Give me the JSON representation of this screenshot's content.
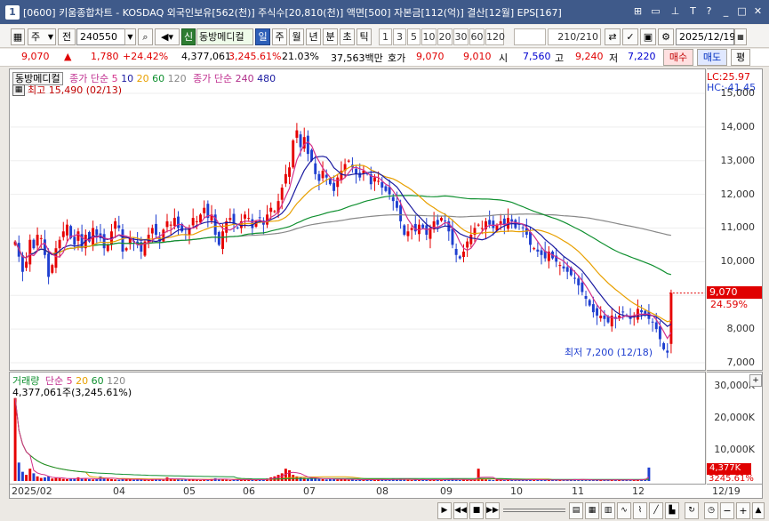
{
  "window": {
    "title": "[0600] 키움종합차트 - KOSDAQ 외국인보유[562(천)] 주식수[20,810(천)] 액면[500] 자본금[112(억)] 결산[12월] EPS[167]",
    "index": "1"
  },
  "toolbar": {
    "market": "주",
    "kind": "전",
    "code": "240550",
    "badge_credit": "신",
    "stock_name": "동방메디컬",
    "periods": [
      "일",
      "주",
      "월",
      "년",
      "분",
      "초",
      "틱"
    ],
    "active_period": "일",
    "intervals": [
      "1",
      "3",
      "5",
      "10",
      "20",
      "30",
      "60",
      "120"
    ],
    "count": "210/210",
    "date": "2025/12/19"
  },
  "quote": {
    "price": "9,070",
    "arrow": "▲",
    "change": "1,780",
    "rate": "+24.42%",
    "volume": "4,377,061",
    "vol_ratio": "3,245.61%",
    "turnover": "21.03%",
    "amount": "37,563백만",
    "hoga_label": "호가",
    "hoga_ask": "9,070",
    "hoga_bid": "9,010",
    "open_label": "시",
    "open": "7,560",
    "high_label": "고",
    "high": "9,240",
    "low_label": "저",
    "low": "7,220",
    "buy": "매수",
    "sell": "매도",
    "avg": "평"
  },
  "price_legend": {
    "name": "동방메디컬",
    "ma_label": "종가 단순",
    "ma": [
      "5",
      "10",
      "20",
      "60",
      "120"
    ],
    "ma2_label": "종가 단순",
    "ma2": [
      "240",
      "480"
    ],
    "max_label": "최고 15,490 (02/13)",
    "min_label": "최저 7,200 (12/18)"
  },
  "price_scale": {
    "lc": "LC:25.97",
    "hc": "HC:-41.45",
    "ticks": [
      "15,000",
      "14,000",
      "13,000",
      "12,000",
      "11,000",
      "10,000",
      "9,000",
      "8,000",
      "7,000"
    ],
    "cur": "9,070",
    "cur_rate": "24.59%"
  },
  "vol_legend": {
    "name": "거래량",
    "ma_label": "단순",
    "ma": [
      "5",
      "20",
      "60",
      "120"
    ],
    "cur": "4,377,061주(3,245.61%)"
  },
  "vol_scale": {
    "ticks": [
      "30,000K",
      "20,000K",
      "10,000K"
    ],
    "cur": "4,377K",
    "cur_rate": "3245.61%"
  },
  "dates": [
    "2025/02",
    "04",
    "05",
    "06",
    "07",
    "08",
    "09",
    "10",
    "11",
    "12",
    "12/19"
  ],
  "colors": {
    "up": "#e60000",
    "down": "#1f3fd0",
    "ma5": "#d4308a",
    "ma10": "#1a1aa0",
    "ma20": "#e8a000",
    "ma60": "#109030",
    "ma120": "#888888",
    "ma240": "#b0308a"
  },
  "chart_data": {
    "type": "candlestick",
    "ylim": [
      7000,
      15500
    ],
    "closes": [
      10600,
      10150,
      9700,
      10000,
      10650,
      10400,
      10800,
      10700,
      10200,
      9550,
      9900,
      10400,
      10650,
      10900,
      11100,
      10700,
      10500,
      10900,
      10400,
      10800,
      10600,
      11000,
      10800,
      10700,
      10400,
      10500,
      10900,
      11200,
      11000,
      10300,
      10400,
      10700,
      10600,
      10500,
      10300,
      10600,
      10800,
      11000,
      10800,
      10600,
      10950,
      11200,
      11100,
      11300,
      11000,
      10900,
      10800,
      11000,
      11300,
      11200,
      11400,
      11600,
      11300,
      11400,
      10800,
      10500,
      10900,
      11200,
      11300,
      11100,
      11000,
      11200,
      11400,
      11300,
      11000,
      11200,
      11300,
      11100,
      11400,
      11600,
      11500,
      11800,
      12200,
      12600,
      12800,
      13600,
      13900,
      13400,
      13700,
      13200,
      13000,
      12600,
      12400,
      12700,
      12500,
      12300,
      12100,
      12500,
      12700,
      12900,
      13000,
      12800,
      12600,
      12500,
      12700,
      12600,
      12300,
      12500,
      12400,
      12200,
      12100,
      12000,
      11800,
      11600,
      11200,
      10800,
      10900,
      11000,
      10900,
      11100,
      11000,
      10800,
      11000,
      11200,
      11100,
      11300,
      11200,
      10900,
      10500,
      10200,
      10100,
      10300,
      10600,
      10800,
      11000,
      11100,
      11000,
      11200,
      11100,
      11000,
      11100,
      11200,
      11100,
      11300,
      11200,
      11000,
      11100,
      11000,
      10800,
      10500,
      10400,
      10300,
      10200,
      10100,
      10300,
      10100,
      10000,
      9900,
      9800,
      9700,
      9600,
      9500,
      9300,
      9100,
      8900,
      8700,
      8500,
      8400,
      8400,
      8300,
      8200,
      8400,
      8300,
      8400,
      8500,
      8400,
      8300,
      8400,
      8600,
      8500,
      8400,
      8300,
      8200,
      8000,
      7700,
      7400,
      7300,
      9070
    ],
    "volume_k": [
      27000,
      6000,
      3000,
      2000,
      4000,
      2500,
      1500,
      1000,
      1200,
      1500,
      800,
      1000,
      900,
      700,
      600,
      700,
      900,
      1200,
      800,
      700,
      600,
      500,
      800,
      1500,
      1000,
      700,
      600,
      500,
      400,
      900,
      600,
      500,
      400,
      500,
      600,
      400,
      300,
      600,
      700,
      500,
      400,
      1200,
      800,
      600,
      500,
      400,
      700,
      600,
      500,
      400,
      300,
      500,
      400,
      700,
      900,
      600,
      500,
      400,
      300,
      500,
      600,
      400,
      500,
      400,
      300,
      400,
      500,
      600,
      800,
      1200,
      1500,
      2000,
      2500,
      4000,
      3500,
      2000,
      1500,
      1200,
      1000,
      800,
      900,
      1100,
      700,
      600,
      500,
      800,
      600,
      500,
      700,
      600,
      400,
      500,
      300,
      400,
      600,
      500,
      400,
      300,
      500,
      600,
      400,
      300,
      700,
      500,
      800,
      600,
      400,
      300,
      500,
      400,
      600,
      300,
      400,
      500,
      300,
      400,
      500,
      600,
      800,
      400,
      300,
      500,
      400,
      300,
      500,
      4000,
      800,
      500,
      400,
      300,
      500,
      400,
      300,
      500,
      300,
      400,
      300,
      400,
      500,
      600,
      400,
      300,
      400,
      300,
      500,
      400,
      300,
      400,
      300,
      400,
      500,
      600,
      400,
      500,
      300,
      400,
      300,
      400,
      500,
      300,
      400,
      300,
      500,
      400,
      300,
      400,
      500,
      300,
      400,
      600,
      700,
      4377
    ]
  }
}
